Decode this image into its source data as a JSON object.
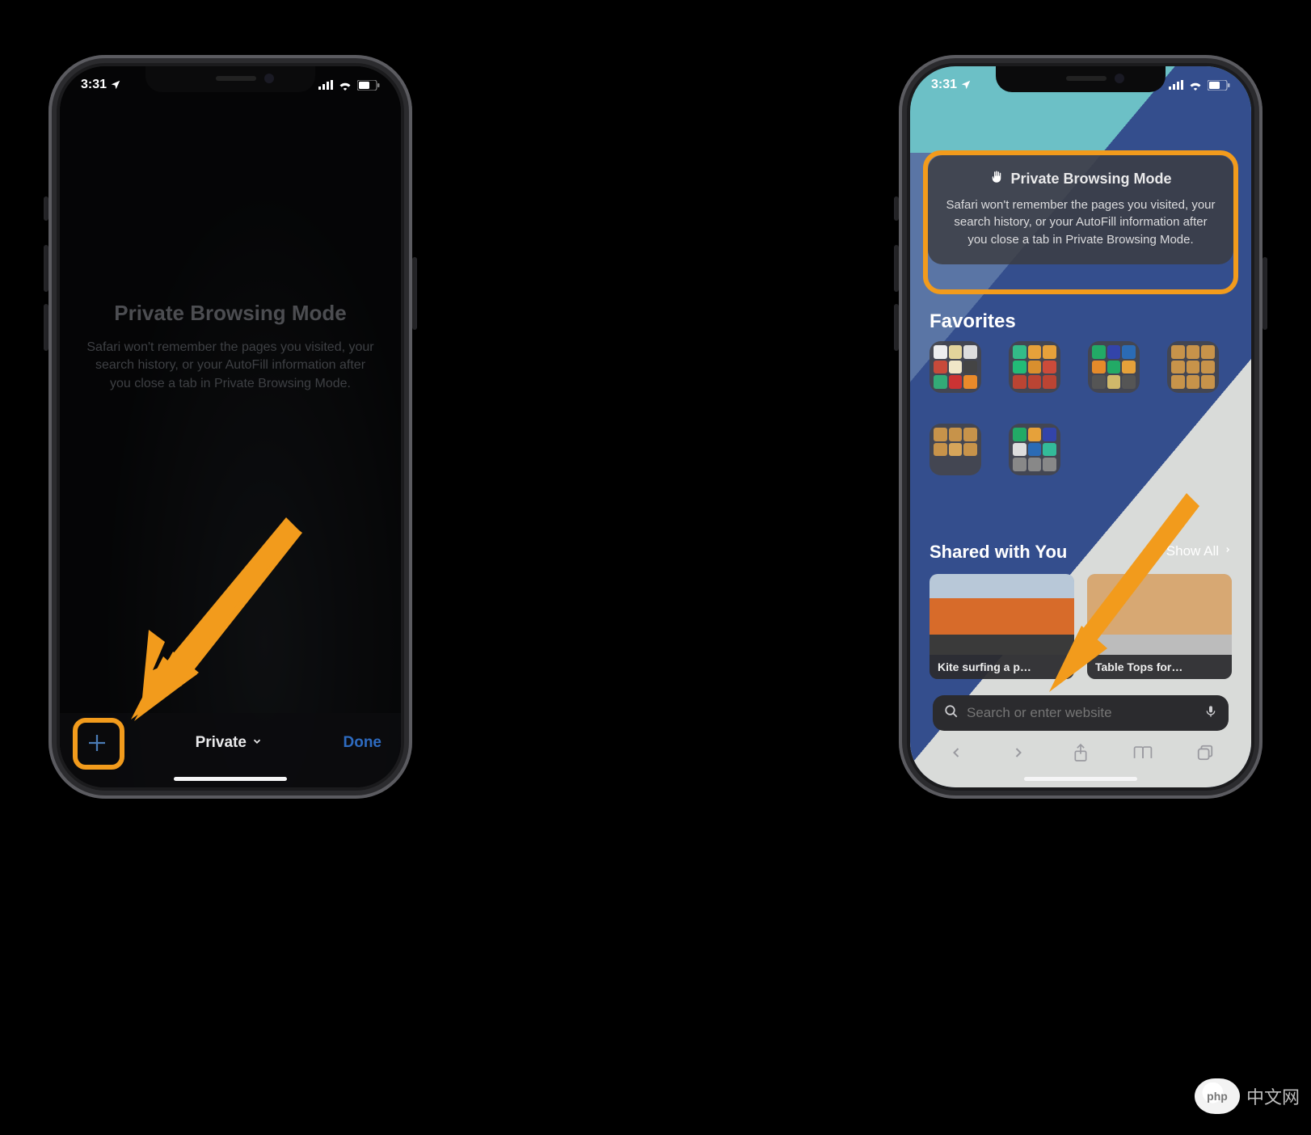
{
  "status": {
    "time": "3:31",
    "location_on": true
  },
  "left": {
    "pbm_title": "Private Browsing Mode",
    "pbm_body": "Safari won't remember the pages you visited, your search history, or your AutoFill information after you close a tab in Private Browsing Mode.",
    "bottom": {
      "private_label": "Private",
      "done_label": "Done"
    }
  },
  "right": {
    "card": {
      "title": "Private Browsing Mode",
      "body": "Safari won't remember the pages you visited, your search history, or your AutoFill information after you close a tab in Private Browsing Mode."
    },
    "favorites_heading": "Favorites",
    "shared_heading": "Shared with You",
    "show_all_label": "Show All",
    "shared_items": [
      {
        "label": "Kite surfing a p…"
      },
      {
        "label": "Table Tops for…"
      }
    ],
    "search_placeholder": "Search or enter website"
  },
  "watermark": "中文网"
}
